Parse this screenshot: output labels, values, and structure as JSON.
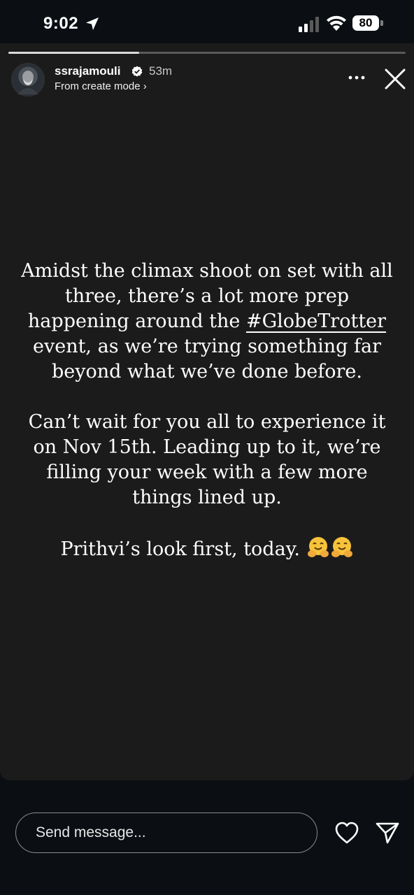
{
  "status_bar": {
    "time": "9:02",
    "battery": "80",
    "icons": [
      "location-arrow-icon",
      "signal-icon",
      "wifi-icon",
      "battery-icon"
    ]
  },
  "story": {
    "progress": 0.33,
    "username": "ssrajamouli",
    "verified": true,
    "time_ago": "53m",
    "subtitle": "From create mode ›",
    "text": {
      "p1_part1": "Amidst the climax shoot on set with all three, there’s a lot more prep happening around the ",
      "hashtag": "#GlobeTrotter",
      "p1_part2": " event, as we’re trying something far beyond what we’ve done before.",
      "p2": "Can’t wait for you all to experience it on Nov 15th. Leading up to it, we’re filling your week with a few more things lined up.",
      "p3": "Prithvi’s look first, today. "
    },
    "emoji": "hugging-face-icon x2"
  },
  "bottom_bar": {
    "send_placeholder": "Send message...",
    "icons": [
      "heart-icon",
      "share-icon"
    ]
  },
  "colors": {
    "background": "#0b0f14",
    "card": "#1b1b1b",
    "text": "#ffffff",
    "progress": "#d9d9d9"
  }
}
